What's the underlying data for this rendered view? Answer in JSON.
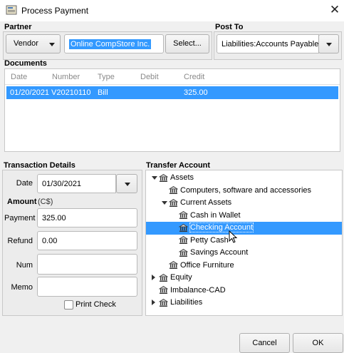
{
  "window": {
    "title": "Process Payment",
    "close_glyph": "✕"
  },
  "partner": {
    "label": "Partner",
    "type_value": "Vendor",
    "name_value": "Online CompStore Inc.",
    "select_button": "Select..."
  },
  "post_to": {
    "label": "Post To",
    "value": "Liabilities:Accounts Payable:l"
  },
  "documents": {
    "label": "Documents",
    "columns": [
      "Date",
      "Number",
      "Type",
      "Debit",
      "Credit"
    ],
    "rows": [
      {
        "date": "01/20/2021",
        "number": "V20210110",
        "type": "Bill",
        "debit": "",
        "credit": "325.00"
      }
    ]
  },
  "transaction": {
    "label": "Transaction Details",
    "date_label": "Date",
    "date_value": "01/30/2021",
    "amount_label": "Amount",
    "currency": "(C$)",
    "payment_label": "Payment",
    "payment_value": "325.00",
    "refund_label": "Refund",
    "refund_value": "0.00",
    "num_label": "Num",
    "num_value": "",
    "memo_label": "Memo",
    "memo_value": "",
    "print_check_label": "Print Check",
    "print_check_checked": false
  },
  "transfer": {
    "label": "Transfer Account",
    "tree": [
      {
        "name": "Assets",
        "expander": "down",
        "level": 0
      },
      {
        "name": "Computers, software and accessories",
        "expander": "none",
        "level": 1
      },
      {
        "name": "Current Assets",
        "expander": "down",
        "level": 1
      },
      {
        "name": "Cash in Wallet",
        "expander": "none",
        "level": 2
      },
      {
        "name": "Checking Account",
        "expander": "none",
        "level": 2,
        "selected": true
      },
      {
        "name": "Petty Cash",
        "expander": "none",
        "level": 2
      },
      {
        "name": "Savings Account",
        "expander": "none",
        "level": 2
      },
      {
        "name": "Office Furniture",
        "expander": "none",
        "level": 1
      },
      {
        "name": "Equity",
        "expander": "right",
        "level": 0
      },
      {
        "name": "Imbalance-CAD",
        "expander": "none",
        "level": 0
      },
      {
        "name": "Liabilities",
        "expander": "right",
        "level": 0
      }
    ]
  },
  "buttons": {
    "cancel": "Cancel",
    "ok": "OK"
  },
  "colors": {
    "selection": "#3399ff",
    "window_bg": "#f0f0f0"
  }
}
